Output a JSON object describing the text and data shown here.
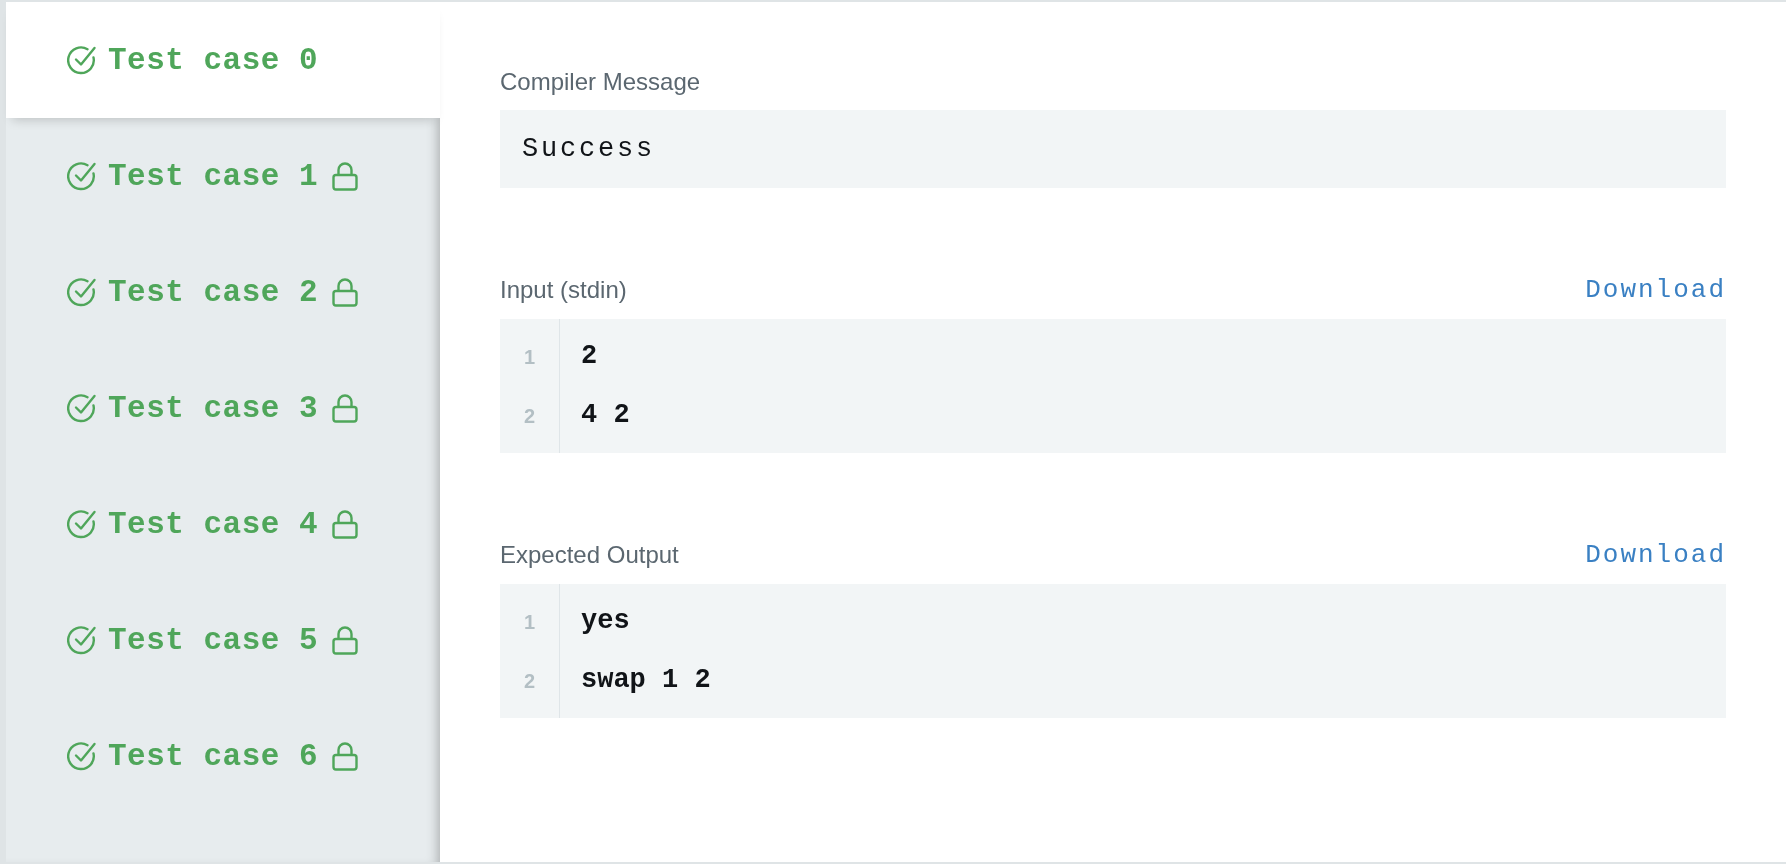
{
  "tests": [
    {
      "label": "Test case 0",
      "passed": true,
      "locked": false,
      "selected": true
    },
    {
      "label": "Test case 1",
      "passed": true,
      "locked": true,
      "selected": false
    },
    {
      "label": "Test case 2",
      "passed": true,
      "locked": true,
      "selected": false
    },
    {
      "label": "Test case 3",
      "passed": true,
      "locked": true,
      "selected": false
    },
    {
      "label": "Test case 4",
      "passed": true,
      "locked": true,
      "selected": false
    },
    {
      "label": "Test case 5",
      "passed": true,
      "locked": true,
      "selected": false
    },
    {
      "label": "Test case 6",
      "passed": true,
      "locked": true,
      "selected": false
    }
  ],
  "compiler_message": {
    "label": "Compiler Message",
    "text": "Success"
  },
  "sections": [
    {
      "label": "Input (stdin)",
      "download": "Download",
      "lines": [
        {
          "number": "1",
          "text": "2"
        },
        {
          "number": "2",
          "text": "4 2"
        }
      ]
    },
    {
      "label": "Expected Output",
      "download": "Download",
      "lines": [
        {
          "number": "1",
          "text": "yes"
        },
        {
          "number": "2",
          "text": "swap 1 2"
        }
      ]
    }
  ]
}
